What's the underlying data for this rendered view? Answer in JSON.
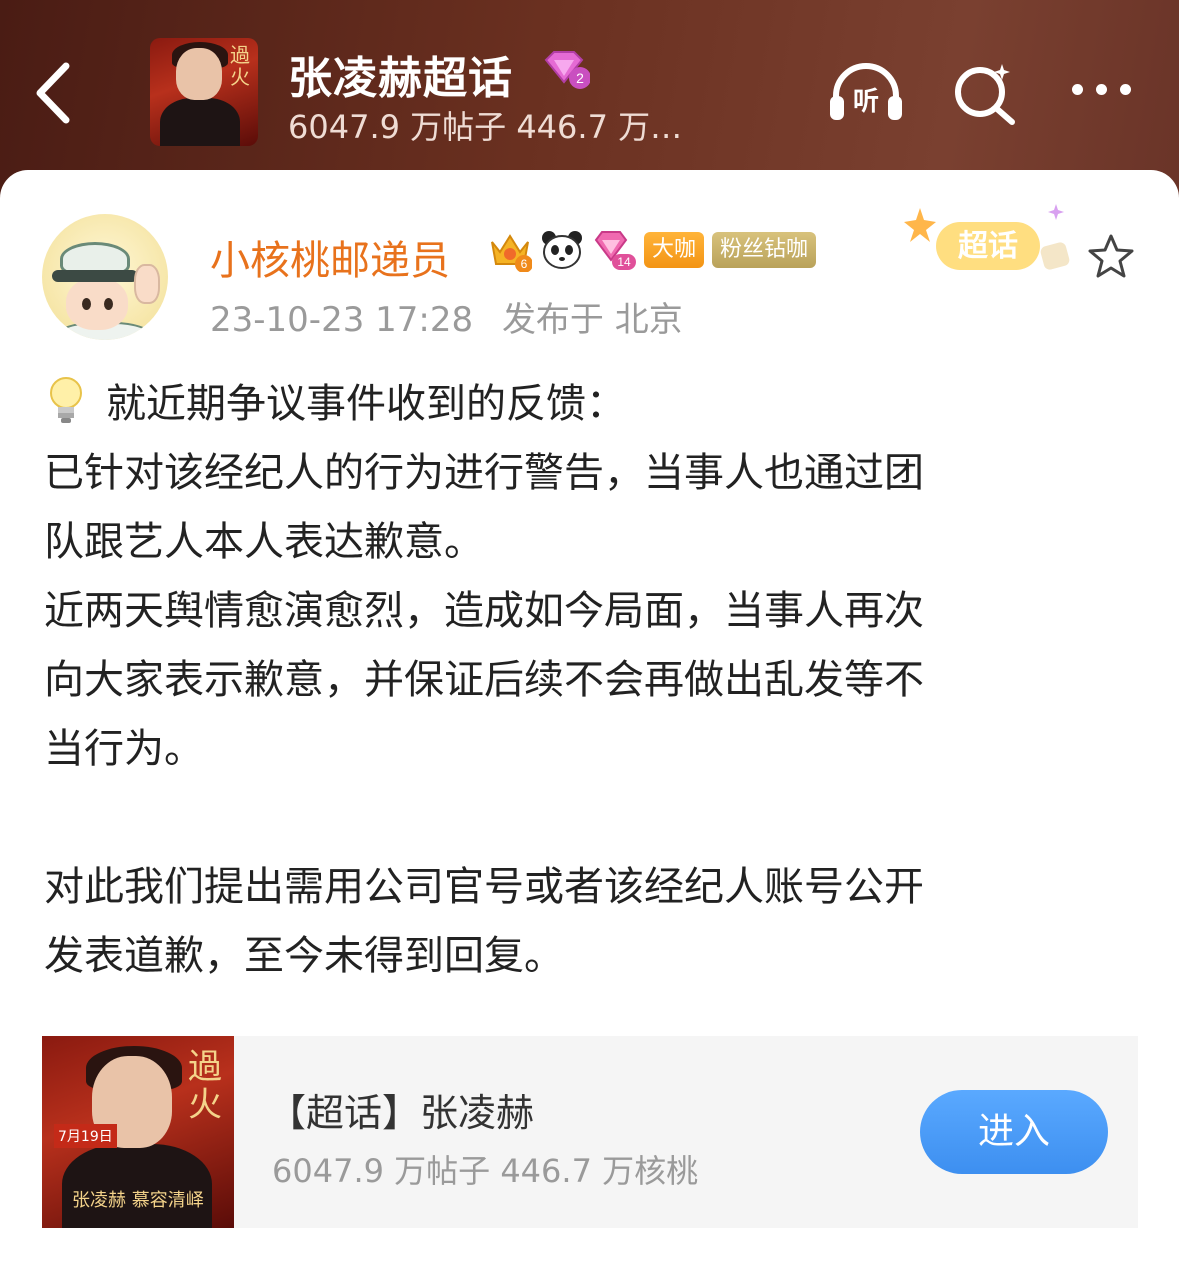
{
  "header": {
    "title": "张凌赫超话",
    "level": "2",
    "stats": "6047.9 万帖子 446.7 万…",
    "listen_label": "听",
    "cover": {
      "calligraphy": "過火"
    }
  },
  "post": {
    "author": {
      "name": "小核桃邮递员",
      "crown_level": "6",
      "diamond_level": "14",
      "tags": [
        "大咖",
        "粉丝钻咖"
      ]
    },
    "timestamp": "23-10-23 17:28",
    "location": "发布于 北京",
    "chaohua_badge": "超话",
    "lines": [
      "就近期争议事件收到的反馈：",
      "已针对该经纪人的行为进行警告，当事人也通过团",
      "队跟艺人本人表达歉意。",
      "近两天舆情愈演愈烈，造成如今局面，当事人再次",
      "向大家表示歉意，并保证后续不会再做出乱发等不",
      "当行为。",
      "",
      "对此我们提出需用公司官号或者该经纪人账号公开",
      "发表道歉，至今未得到回复。"
    ]
  },
  "topic_card": {
    "title": "【超话】张凌赫",
    "stats": "6047.9 万帖子 446.7 万核桃",
    "enter_label": "进入",
    "cover": {
      "calligraphy": "過火",
      "date": "7月19日",
      "name": "张凌赫 慕容清峄"
    }
  },
  "colors": {
    "username": "#e8721c",
    "enter_button": "#4a9af8",
    "header_bg": "#6a3020"
  }
}
